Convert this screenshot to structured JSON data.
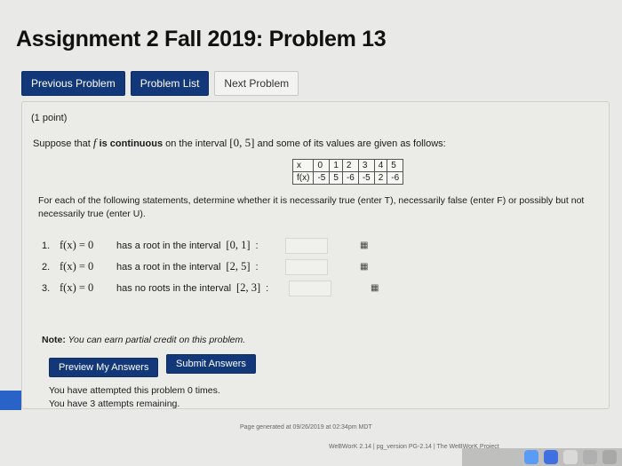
{
  "page": {
    "title": "Assignment 2 Fall 2019: Problem 13"
  },
  "nav": {
    "previous": "Previous Problem",
    "list": "Problem List",
    "next": "Next Problem"
  },
  "problem": {
    "points": "(1 point)",
    "intro_a": "Suppose that ",
    "f": "f",
    "intro_b": " is continuous",
    "intro_c": " on the interval ",
    "interval": "[0, 5]",
    "intro_d": " and some of its values are given as follows:",
    "table": {
      "x_header": "x",
      "x_values": [
        "0",
        "1",
        "2",
        "3",
        "4",
        "5"
      ],
      "fx_header": "f(x)",
      "fx_values": [
        "-5",
        "5",
        "-6",
        "-5",
        "2",
        "-6"
      ]
    },
    "instructions": "For each of the following statements, determine whether it is necessarily true (enter T), necessarily false (enter F) or possibly but not necessarily true (enter U).",
    "questions": [
      {
        "num": "1.",
        "fx": "f(x) = 0",
        "text": "has a root in the interval",
        "interval": "[0, 1]",
        "colon": ":"
      },
      {
        "num": "2.",
        "fx": "f(x) = 0",
        "text": "has a root in the interval",
        "interval": "[2, 5]",
        "colon": ":"
      },
      {
        "num": "3.",
        "fx": "f(x) = 0",
        "text": "has no roots in the interval",
        "interval": "[2, 3]",
        "colon": ":"
      }
    ],
    "note_label": "Note:",
    "note_text": " You can earn partial credit on this problem.",
    "preview": "Preview My Answers",
    "submit": "Submit Answers",
    "attempted": "You have attempted this problem 0 times.",
    "remaining": "You have 3 attempts remaining."
  },
  "footer": {
    "generated": "Page generated at 09/26/2019 at 02:34pm MDT",
    "version": "WeBWorK 2.14 | pg_version PG-2.14 | The WeBWorK Project"
  },
  "icons": [
    "grid-icon"
  ]
}
